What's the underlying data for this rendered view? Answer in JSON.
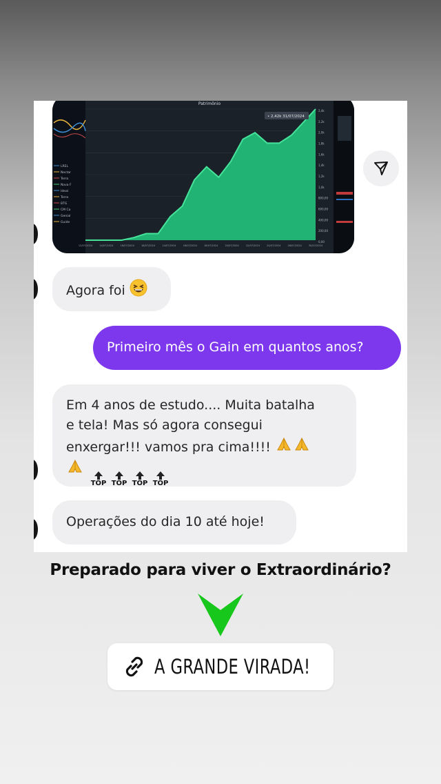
{
  "conversation": {
    "photo_chart": {
      "title": "Patrimônio",
      "legend_items": [
        "LREL",
        "Nectar",
        "Terra",
        "Nova F",
        "Ideal",
        "Terra",
        "BTG",
        "CM Ca",
        "Genial",
        "Guide"
      ],
      "x_ticks": [
        "12/07/2024",
        "14/07/2024",
        "16/07/2024",
        "18/07/2024",
        "14/07/2024",
        "16/07/2024",
        "18/07/2024",
        "20/07/2024",
        "22/07/2024",
        "24/07/2024",
        "26/07/2024",
        "30/07/2024"
      ],
      "y_ticks": [
        "2,4k",
        "2,2k",
        "2,0k",
        "1,8k",
        "1,6k",
        "1,4k",
        "1,2k",
        "1,0k",
        "800,00",
        "600,00",
        "400,00",
        "200,00",
        "0,00"
      ],
      "tooltip": "• 2,42k   31/07/2024",
      "values": [
        0,
        0,
        0,
        0,
        0.02,
        0.05,
        0.05,
        0.18,
        0.26,
        0.46,
        0.56,
        0.48,
        0.6,
        0.77,
        0.82,
        0.74,
        0.74,
        0.8,
        0.9,
        1.0
      ]
    },
    "messages": [
      {
        "from": "them",
        "text": "Agora foi",
        "emoji": "grinning-squinting-face"
      },
      {
        "from": "me",
        "text": "Primeiro mês o Gain em quantos anos?"
      },
      {
        "from": "them",
        "line1": "Em 4 anos de estudo.... Muita batalha",
        "line2": "e tela! Mas só agora consegui",
        "line3": "enxergar!!! vamos pra cima!!!!",
        "top_label": "TOP",
        "emojis": [
          "folded-hands",
          "folded-hands",
          "folded-hands",
          "top-arrow",
          "top-arrow",
          "top-arrow",
          "top-arrow"
        ]
      },
      {
        "from": "them",
        "text": "Operações do dia 10 até hoje!"
      }
    ]
  },
  "overlay": {
    "headline": "Preparado para viver o Extraordinário?",
    "arrow_color": "#18c71c",
    "link_sticker": {
      "icon": "link-icon",
      "label": "A GRANDE VIRADA!"
    }
  },
  "colors": {
    "outgoing_bubble": "#7d38ee",
    "incoming_bubble": "#efeff1",
    "chart_fill": "#22c07a"
  }
}
